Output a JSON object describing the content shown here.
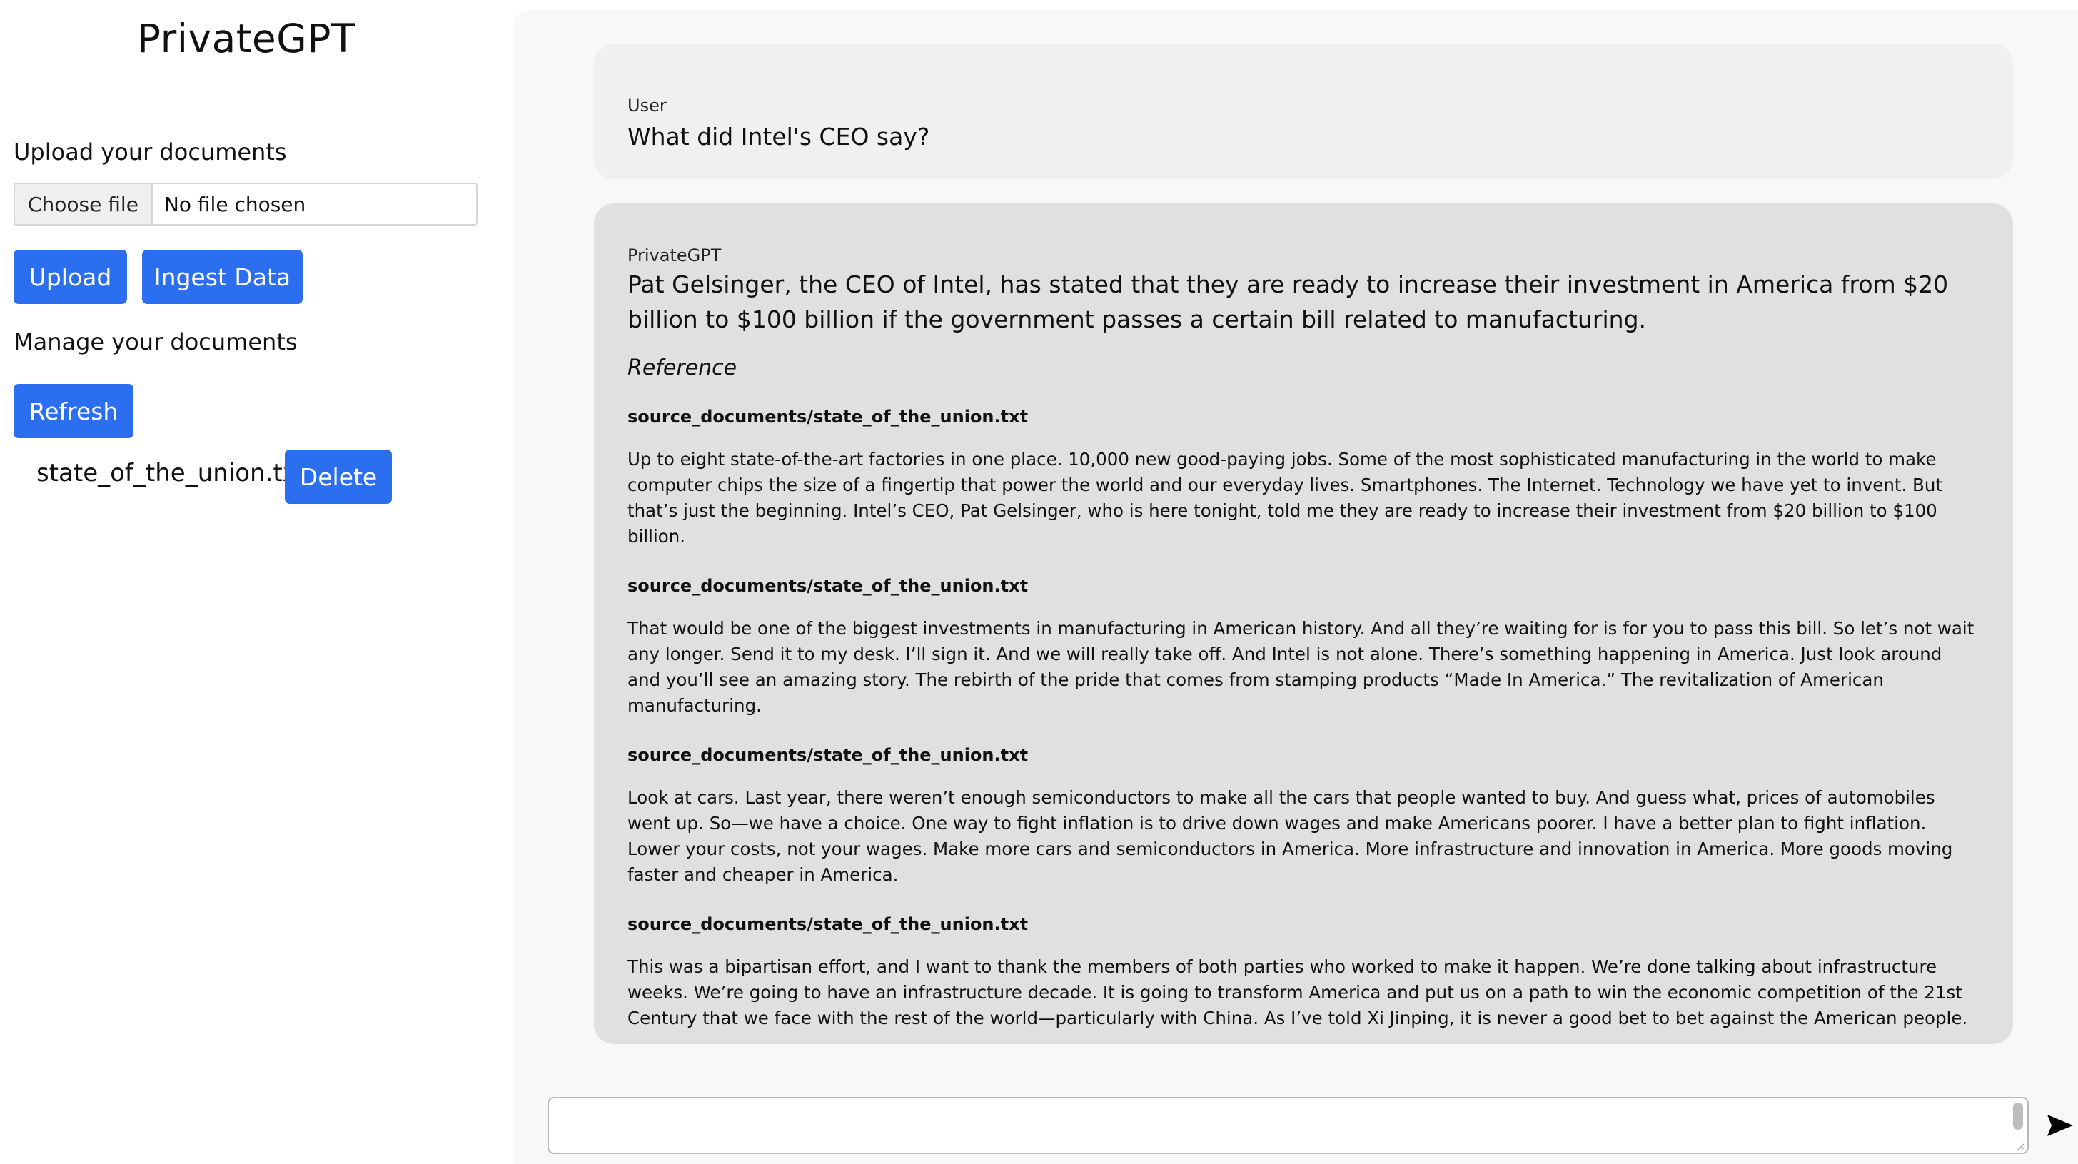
{
  "sidebar": {
    "app_title": "PrivateGPT",
    "upload_heading": "Upload your documents",
    "file_input": {
      "button_label": "Choose file",
      "status": "No file chosen"
    },
    "upload_button": "Upload",
    "ingest_button": "Ingest Data",
    "manage_heading": "Manage your documents",
    "refresh_button": "Refresh",
    "documents": [
      {
        "name": "state_of_the_union.txt",
        "delete_label": "Delete"
      }
    ]
  },
  "chat": {
    "messages": [
      {
        "role": "User",
        "text": "What did Intel's CEO say?"
      },
      {
        "role": "PrivateGPT",
        "text": "Pat Gelsinger, the CEO of Intel, has stated that they are ready to increase their investment in America from $20 billion to $100 billion if the government passes a certain bill related to manufacturing.",
        "reference_heading": "Reference",
        "sources": [
          {
            "title": "source_documents/state_of_the_union.txt",
            "text": "Up to eight state-of-the-art factories in one place. 10,000 new good-paying jobs. Some of the most sophisticated manufacturing in the world to make computer chips the size of a fingertip that power the world and our everyday lives. Smartphones. The Internet. Technology we have yet to invent. But that’s just the beginning. Intel’s CEO, Pat Gelsinger, who is here tonight, told me they are ready to increase their investment from $20 billion to $100 billion."
          },
          {
            "title": "source_documents/state_of_the_union.txt",
            "text": "That would be one of the biggest investments in manufacturing in American history. And all they’re waiting for is for you to pass this bill. So let’s not wait any longer. Send it to my desk. I’ll sign it. And we will really take off. And Intel is not alone. There’s something happening in America. Just look around and you’ll see an amazing story. The rebirth of the pride that comes from stamping products “Made In America.” The revitalization of American manufacturing."
          },
          {
            "title": "source_documents/state_of_the_union.txt",
            "text": "Look at cars. Last year, there weren’t enough semiconductors to make all the cars that people wanted to buy. And guess what, prices of automobiles went up. So—we have a choice. One way to fight inflation is to drive down wages and make Americans poorer. I have a better plan to fight inflation. Lower your costs, not your wages. Make more cars and semiconductors in America. More infrastructure and innovation in America. More goods moving faster and cheaper in America."
          },
          {
            "title": "source_documents/state_of_the_union.txt",
            "text": "This was a bipartisan effort, and I want to thank the members of both parties who worked to make it happen. We’re done talking about infrastructure weeks. We’re going to have an infrastructure decade. It is going to transform America and put us on a path to win the economic competition of the 21st Century that we face with the rest of the world—particularly with China. As I’ve told Xi Jinping, it is never a good bet to bet against the American people."
          }
        ]
      }
    ],
    "composer": {
      "value": "",
      "send_icon": "send-arrow-icon"
    }
  },
  "colors": {
    "accent": "#2b6ff0",
    "user_bubble": "#f0f0f0",
    "bot_bubble": "#e0e0e0",
    "main_bg": "#f8f8f8"
  }
}
